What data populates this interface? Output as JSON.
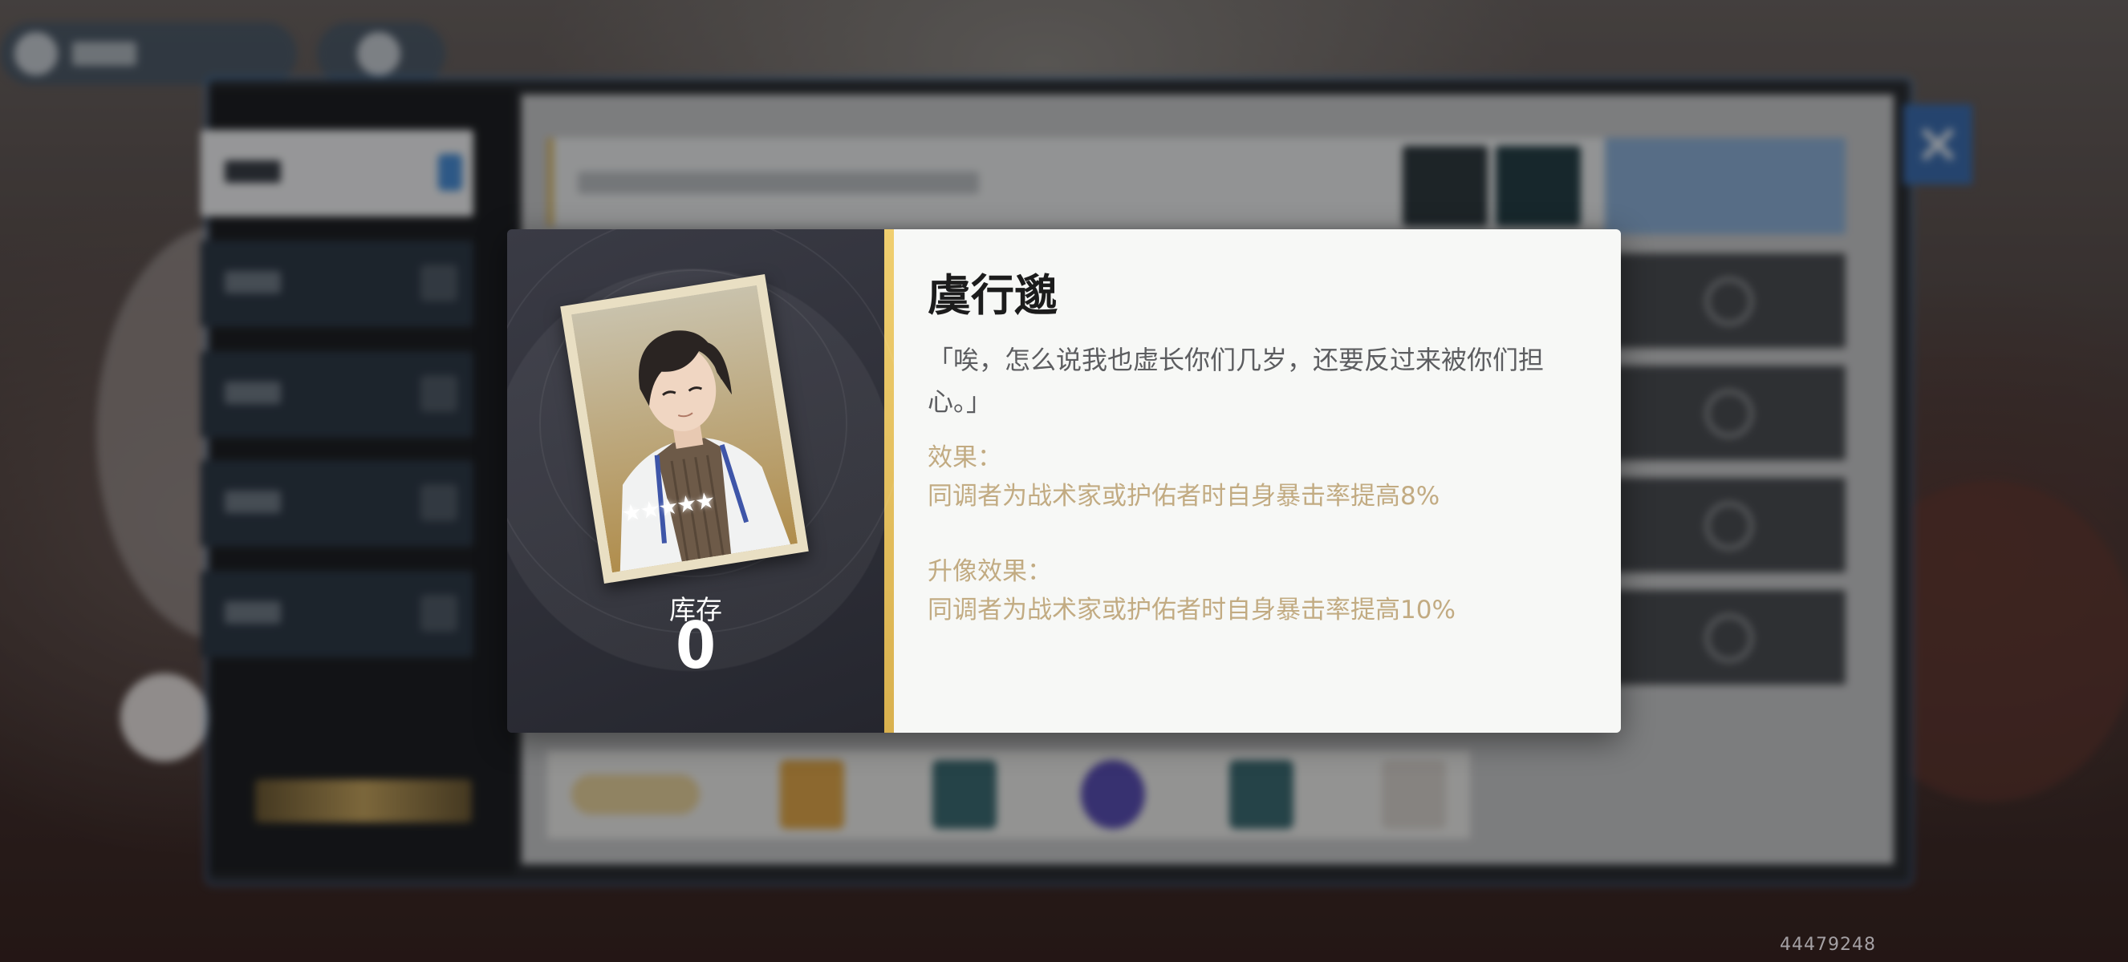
{
  "popup": {
    "character_name": "虞行邈",
    "quote": "「唉，怎么说我也虚长你们几岁，还要反过来被你们担心。」",
    "effect_label": "效果：",
    "effect_text": "同调者为战术家或护佑者时自身暴击率提高8%",
    "upgrade_label": "升像效果：",
    "upgrade_text": "同调者为战术家或护佑者时自身暴击率提高10%",
    "stock_label": "库存",
    "stock_value": "0",
    "star_count": 5,
    "stars": "★★★★★"
  },
  "footer": {
    "uid": "44479248"
  },
  "icons": {
    "close": "close-icon",
    "lock": "lock-icon",
    "arrow": "chevron-right-icon",
    "check": "check-circle-icon"
  },
  "colors": {
    "accent_gold": "#f0cf6f",
    "effect_text": "#c2ab82",
    "title": "#1c1c1c",
    "close_button": "#3d6fb2"
  }
}
